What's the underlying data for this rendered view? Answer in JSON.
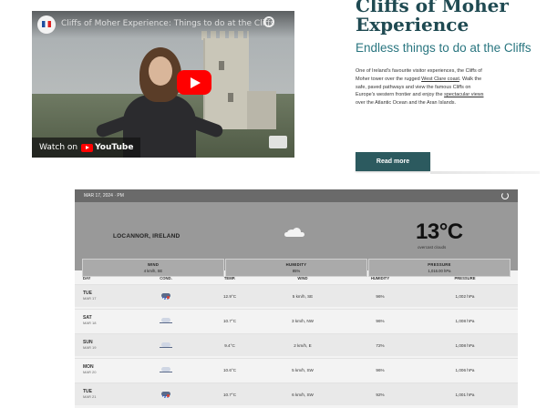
{
  "video": {
    "channel_title": "Cliffs of Moher Experience: Things to do at the Cliffs",
    "watch_on_label": "Watch on",
    "youtube_label": "YouTube"
  },
  "article": {
    "title_line1": "Cliffs of Moher",
    "title_line2": "Experience",
    "subtitle": "Endless things to do at the Cliffs",
    "para_lines": [
      "One of Ireland's favourite visitor experiences, the Cliffs of",
      "Moher tower over the rugged",
      "West Clare coast",
      ". Walk the",
      "safe, paved pathways and view the famous Cliffs on",
      "Europe's western frontier and enjoy the",
      "spectacular views",
      "over the Atlantic Ocean and the Aran Islands."
    ],
    "read_more_label": "Read more"
  },
  "weather": {
    "date_label": "MAR 17, 2024 · PM",
    "location": "LOCANNOR, IRELAND",
    "temperature": "13°C",
    "description": "overcast clouds",
    "stats": [
      {
        "label": "WIND",
        "value": "4 km/h, SE"
      },
      {
        "label": "HUMIDITY",
        "value": "85%"
      },
      {
        "label": "PRESSURE",
        "value": "1,016.00 hPa"
      }
    ],
    "columns": [
      "DAY",
      "COND.",
      "TEMP.",
      "WIND",
      "HUMIDITY",
      "PRESSURE"
    ],
    "rows": [
      {
        "day": "TUE",
        "date": "MAR 17",
        "cond": "rain",
        "temp": "12.9°C",
        "wind": "5 km/h, SE",
        "humidity": "96%",
        "pressure": "1,002 hPa"
      },
      {
        "day": "SAT",
        "date": "MAR 18",
        "cond": "fog",
        "temp": "10.7°C",
        "wind": "3 km/h, NW",
        "humidity": "96%",
        "pressure": "1,008 hPa"
      },
      {
        "day": "SUN",
        "date": "MAR 19",
        "cond": "fog",
        "temp": "9.4°C",
        "wind": "2 km/h, E",
        "humidity": "72%",
        "pressure": "1,008 hPa"
      },
      {
        "day": "MON",
        "date": "MAR 20",
        "cond": "fog",
        "temp": "10.6°C",
        "wind": "5 km/h, SW",
        "humidity": "96%",
        "pressure": "1,006 hPa"
      },
      {
        "day": "TUE",
        "date": "MAR 21",
        "cond": "rain",
        "temp": "10.7°C",
        "wind": "6 km/h, SW",
        "humidity": "92%",
        "pressure": "1,001 hPa"
      }
    ]
  }
}
